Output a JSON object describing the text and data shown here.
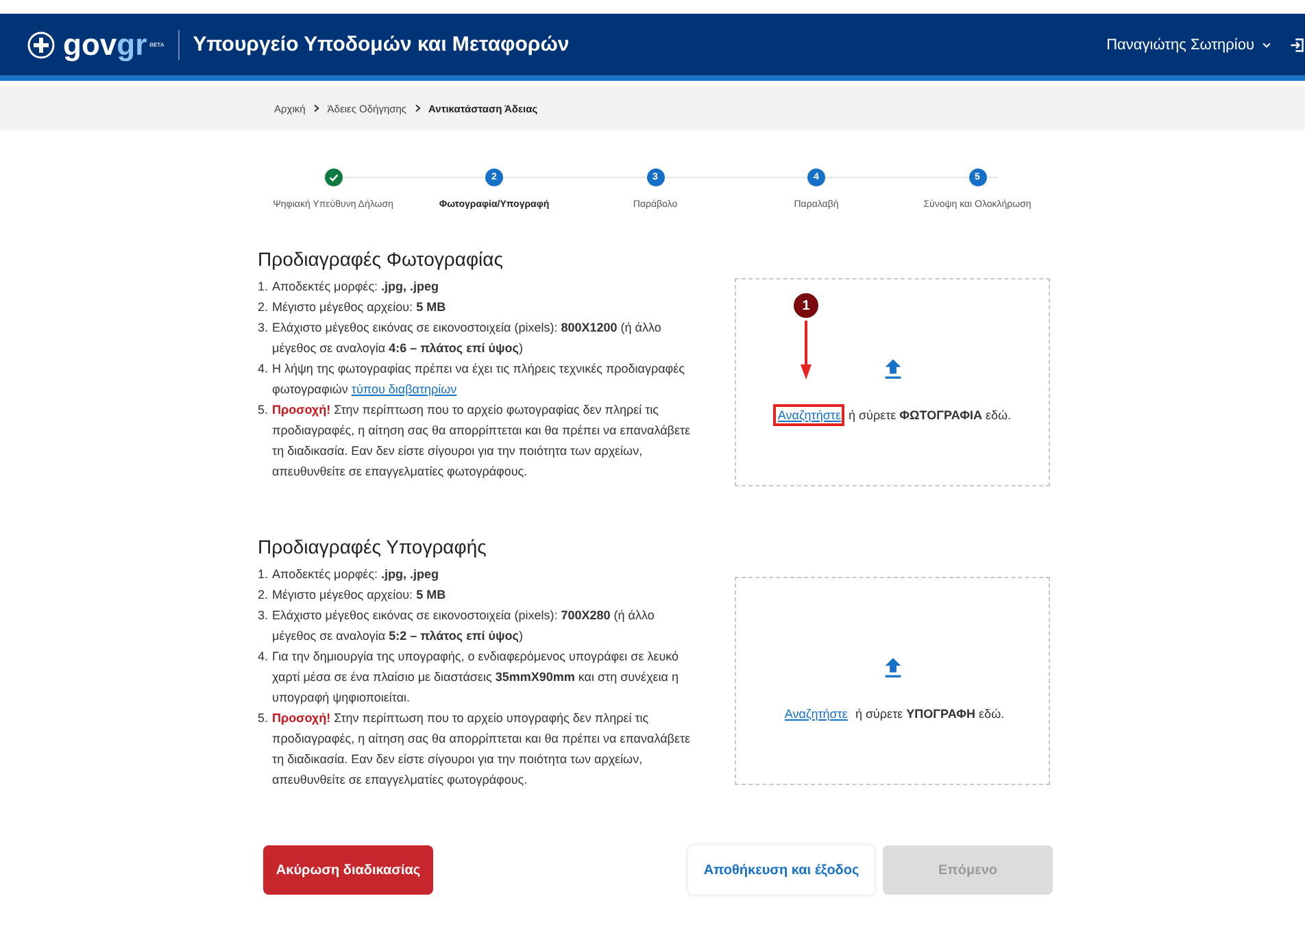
{
  "header": {
    "logo": {
      "first": "gov",
      "second": "gr",
      "badge": "BETA"
    },
    "title": "Υπουργείο Υποδομών και Μεταφορών",
    "user": "Παναγιώτης Σωτηρίου"
  },
  "breadcrumb": [
    {
      "label": "Αρχική",
      "current": false
    },
    {
      "label": "Άδειες Οδήγησης",
      "current": false
    },
    {
      "label": "Αντικατάσταση Άδειας",
      "current": true
    }
  ],
  "steps": [
    {
      "completed": true,
      "selected": false,
      "label": "Ψηφιακή Υπεύθυνη Δήλωση"
    },
    {
      "completed": false,
      "selected": true,
      "number": "2",
      "label": "Φωτογραφία/Υπογραφή"
    },
    {
      "completed": false,
      "selected": false,
      "number": "3",
      "label": "Παράβολο"
    },
    {
      "completed": false,
      "selected": false,
      "number": "4",
      "label": "Παραλαβή"
    },
    {
      "completed": false,
      "selected": false,
      "number": "5",
      "label": "Σύνοψη και Ολοκλήρωση"
    }
  ],
  "sections": [
    {
      "title": "Προδιαγραφές Φωτογραφίας",
      "items": [
        {
          "number": "1.",
          "text": "Αποδεκτές μορφές: **.jpg, .jpeg**"
        },
        {
          "number": "2.",
          "text": "Μέγιστο μέγεθος αρχείου: **5 MB**"
        },
        {
          "number": "3.",
          "text": "Ελάχιστο μέγεθος εικόνας σε εικονοστοιχεία (pixels): **800X1200** (ή άλλο μέγεθος σε αναλογία **4:6 – πλάτος επί ύψος**)"
        },
        {
          "number": "4.",
          "text": "Η λήψη της φωτογραφίας πρέπει να έχει τις πλήρεις τεχνικές προδιαγραφές φωτογραφιών",
          "link": "τύπου διαβατηρίων"
        },
        {
          "number": "5.",
          "warning": "Προσοχή!",
          "text": "Στην περίπτωση που το αρχείο φωτογραφίας δεν πληρεί τις προδιαγραφές, η αίτηση σας θα απορρίπτεται και θα πρέπει να επαναλάβετε τη διαδικασία. Εαν δεν είστε σίγουροι για την ποιότητα των αρχείων, απευθυνθείτε σε επαγγελματίες φωτογράφους."
        }
      ],
      "dropzone": {
        "link": "Αναζητήστε",
        "text": "ή σύρετε **ΦΩΤΟΓΡΑΦΙΑ** εδώ.",
        "highlighted": true,
        "annotation": "1"
      }
    },
    {
      "title": "Προδιαγραφές Υπογραφής",
      "items": [
        {
          "number": "1.",
          "text": "Αποδεκτές μορφές: **.jpg, .jpeg**"
        },
        {
          "number": "2.",
          "text": "Μέγιστο μέγεθος αρχείου: **5 MB**"
        },
        {
          "number": "3.",
          "text": "Ελάχιστο μέγεθος εικόνας σε εικονοστοιχεία (pixels): **700X280** (ή άλλο μέγεθος σε αναλογία **5:2 – πλάτος επί ύψος**)"
        },
        {
          "number": "4.",
          "text": "Για την δημιουργία της υπογραφής, ο ενδιαφερόμενος υπογράφει σε λευκό χαρτί μέσα σε ένα πλαίσιο με διαστάσεις **35mmX90mm** και στη συνέχεια η υπογραφή ψηφιοποιείται."
        },
        {
          "number": "5.",
          "warning": "Προσοχή!",
          "text": "Στην περίπτωση που το αρχείο υπογραφής δεν πληρεί τις προδιαγραφές, η αίτηση σας θα απορρίπτεται και θα πρέπει να επαναλάβετε τη διαδικασία. Εαν δεν είστε σίγουροι για την ποιότητα των αρχείων, απευθυνθείτε σε επαγγελματίες φωτογράφους."
        }
      ],
      "dropzone": {
        "link": "Αναζητήστε",
        "text": "ή σύρετε **ΥΠΟΓΡΑΦΗ** εδώ.",
        "highlighted": false
      }
    }
  ],
  "buttons": [
    {
      "kind": "danger",
      "label": "Ακύρωση διαδικασίας",
      "disabled": false
    },
    {
      "kind": "secondary",
      "label": "Αποθήκευση και έξοδος",
      "disabled": false
    },
    {
      "kind": "primary",
      "label": "Επόμενο",
      "disabled": true
    }
  ]
}
